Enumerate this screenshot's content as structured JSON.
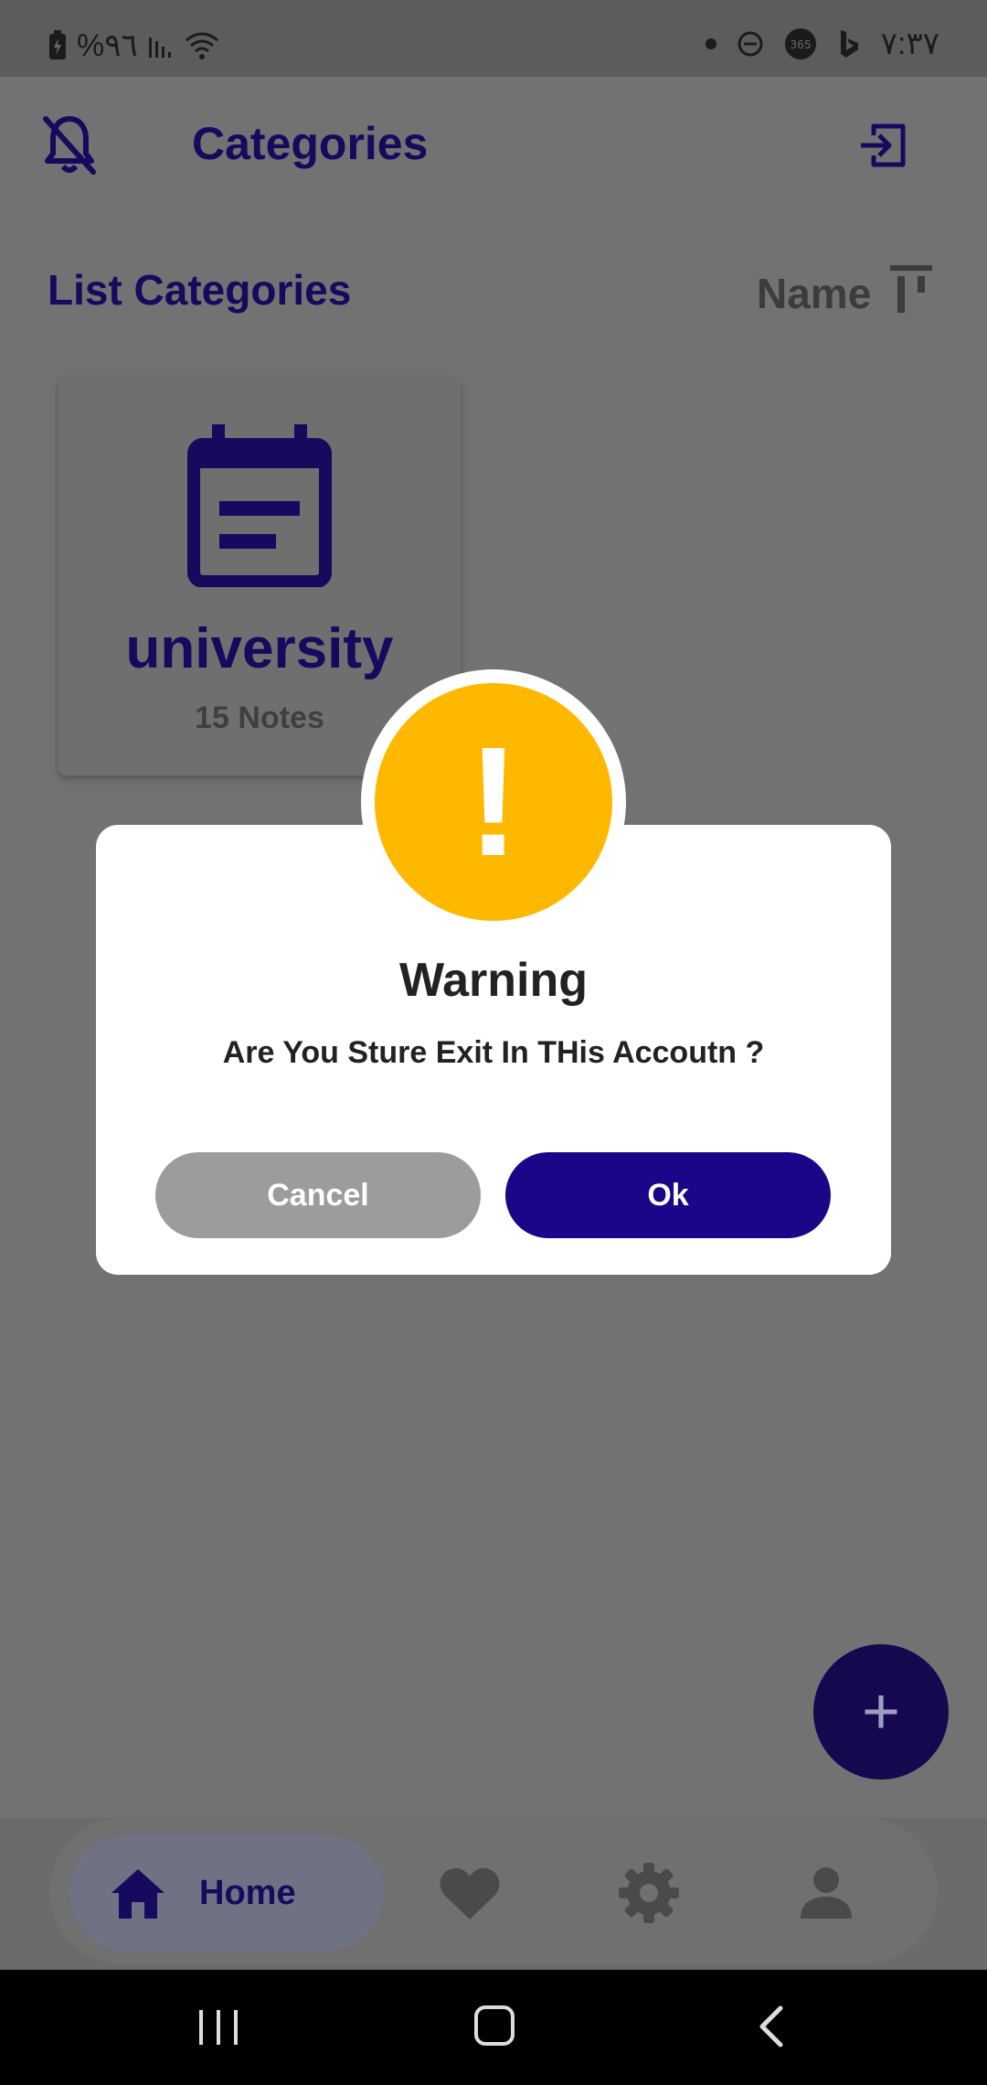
{
  "status_bar": {
    "battery_text": "%٩٦",
    "time": "٧:٣٧"
  },
  "header": {
    "title": "Categories"
  },
  "list_header": {
    "title": "List Categories",
    "sort_label": "Name"
  },
  "categories": [
    {
      "name": "university",
      "notes": "15 Notes"
    }
  ],
  "dialog": {
    "title": "Warning",
    "message": "Are You Sture Exit In THis Accoutn ?",
    "cancel_label": "Cancel",
    "ok_label": "Ok",
    "icon_glyph": "!"
  },
  "fab": {
    "glyph": "+"
  },
  "bottom_nav": {
    "home_label": "Home",
    "items": [
      "home-icon",
      "heart-icon",
      "gear-icon",
      "person-icon"
    ]
  },
  "colors": {
    "primary": "#1a0688",
    "dark_primary": "#150a5e",
    "warning": "#ffb800"
  }
}
